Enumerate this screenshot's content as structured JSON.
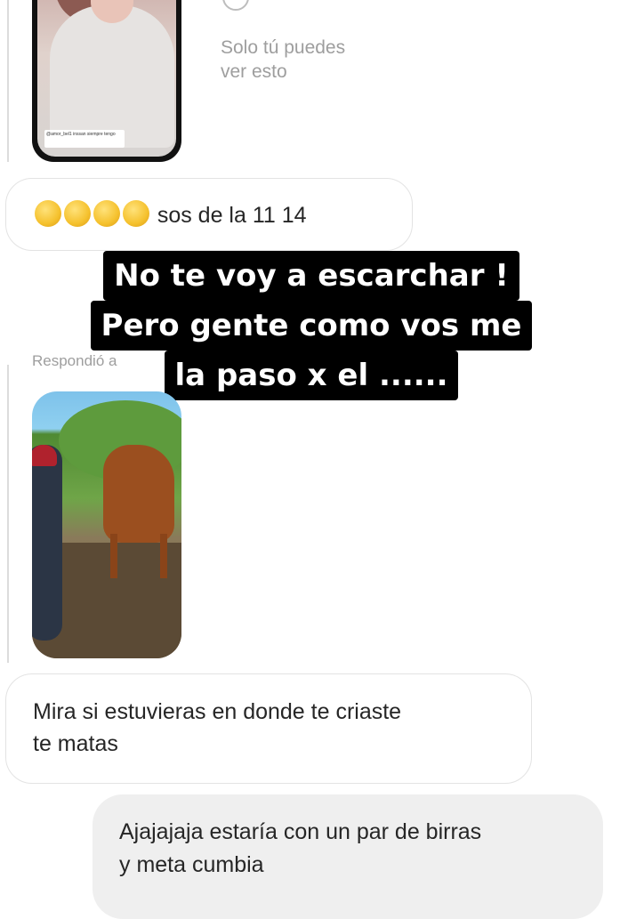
{
  "story_reply": {
    "visibility_note_line1": "Solo tú puedes",
    "visibility_note_line2": "ver esto",
    "story_caption": "@amor_bel1 inssan siempre tengo"
  },
  "messages": [
    {
      "id": "emoji_msg",
      "emojis": [
        "🤣",
        "🤣",
        "🤣",
        "🤣"
      ],
      "text": "sos  de la 11  14"
    },
    {
      "id": "recv_msg",
      "lines": [
        "Mira si estuvieras en donde te criaste",
        "te matas"
      ]
    },
    {
      "id": "sent_msg",
      "lines": [
        "Ajajajaja estaría con un par de birras",
        "y meta cumbia"
      ]
    }
  ],
  "overlay_text": {
    "line1": "No te voy a escarchar !",
    "line2": "Pero gente como vos me",
    "line3": "la paso x el ......"
  },
  "replied_label": "Respondió a",
  "icons": {
    "status_circle": "circle-outline-icon",
    "emoji": "rolling-on-floor-laughing-emoji"
  },
  "colors": {
    "received_bubble_border": "#e3e3e3",
    "sent_bubble_bg": "#efefef",
    "overlay_bg": "#000000",
    "overlay_text": "#ffffff",
    "muted_text": "#9e9e9e"
  }
}
